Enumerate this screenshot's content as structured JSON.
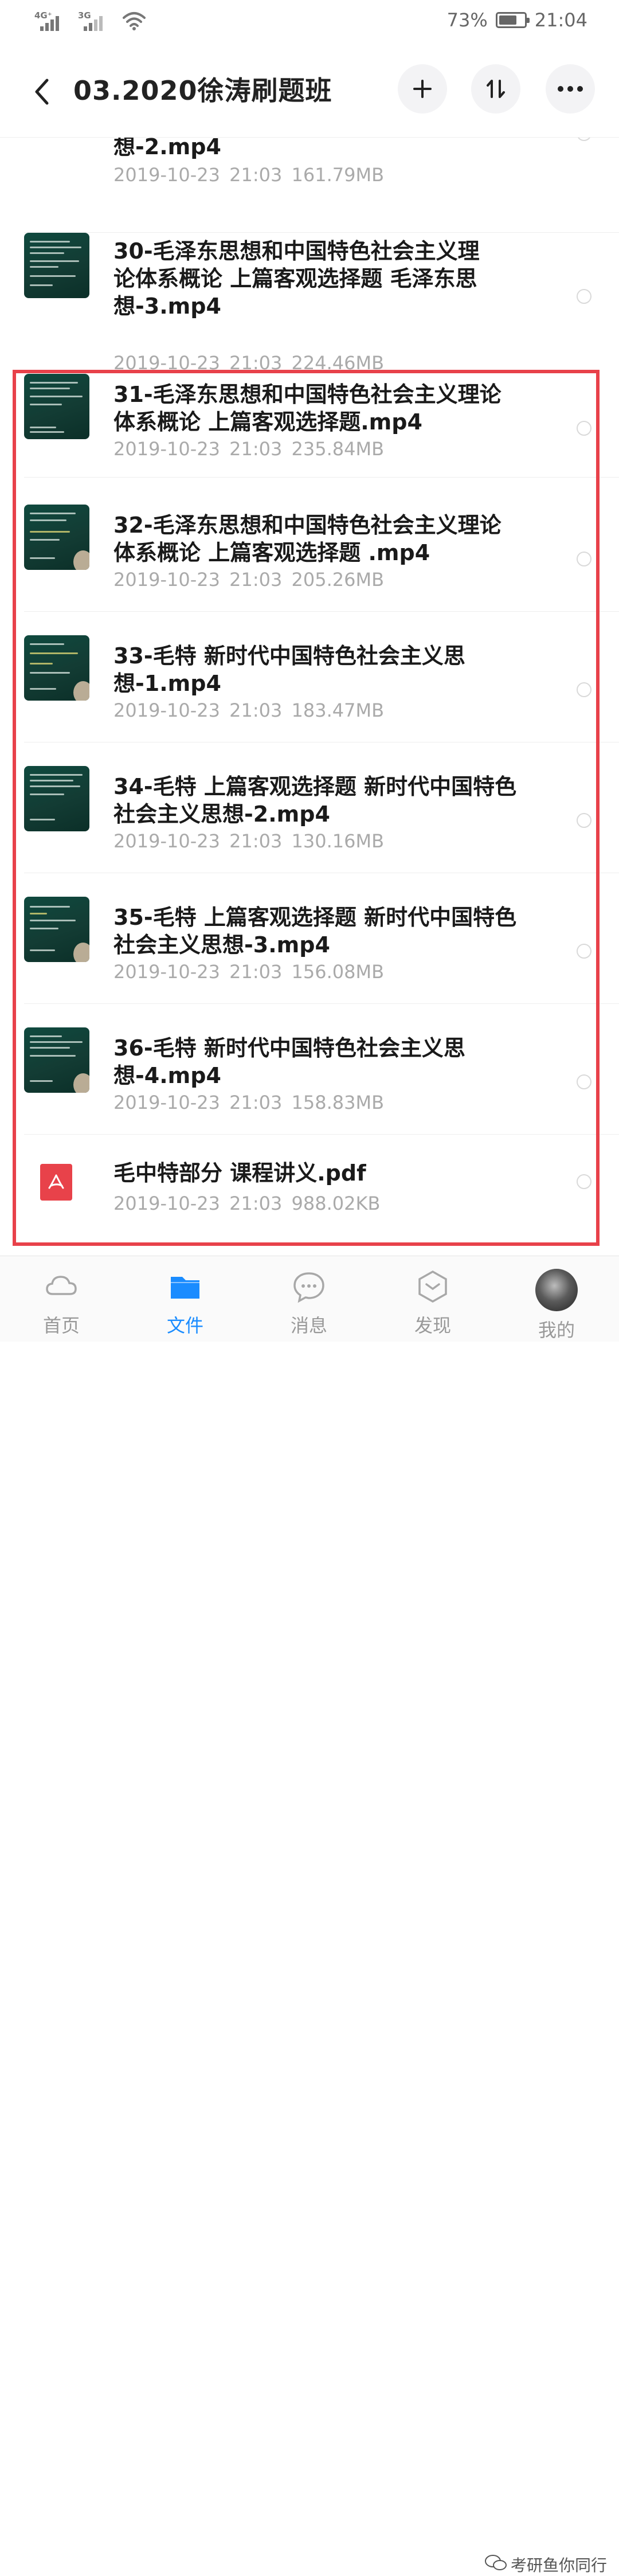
{
  "status": {
    "net1": "4G⁺",
    "net2": "3G",
    "battery": "73%",
    "battery_level": 0.73,
    "time": "21:04"
  },
  "header": {
    "title": "03.2020徐涛刷题班"
  },
  "files": [
    {
      "name": "想-2.mp4",
      "date": "2019-10-23",
      "time": "21:03",
      "size": "161.79MB",
      "type": "video"
    },
    {
      "name": "30-毛泽东思想和中国特色社会主义理\n论体系概论 上篇客观选择题 毛泽东思\n想-3.mp4",
      "date": "2019-10-23",
      "time": "21:03",
      "size": "224.46MB",
      "type": "video"
    },
    {
      "name": "31-毛泽东思想和中国特色社会主义理论\n体系概论 上篇客观选择题.mp4",
      "date": "2019-10-23",
      "time": "21:03",
      "size": "235.84MB",
      "type": "video"
    },
    {
      "name": "32-毛泽东思想和中国特色社会主义理论\n体系概论 上篇客观选择题 .mp4",
      "date": "2019-10-23",
      "time": "21:03",
      "size": "205.26MB",
      "type": "video"
    },
    {
      "name": "33-毛特 新时代中国特色社会主义思\n想-1.mp4",
      "date": "2019-10-23",
      "time": "21:03",
      "size": "183.47MB",
      "type": "video"
    },
    {
      "name": "34-毛特 上篇客观选择题 新时代中国特色\n社会主义思想-2.mp4",
      "date": "2019-10-23",
      "time": "21:03",
      "size": "130.16MB",
      "type": "video"
    },
    {
      "name": "35-毛特 上篇客观选择题 新时代中国特色\n社会主义思想-3.mp4",
      "date": "2019-10-23",
      "time": "21:03",
      "size": "156.08MB",
      "type": "video"
    },
    {
      "name": "36-毛特 新时代中国特色社会主义思\n想-4.mp4",
      "date": "2019-10-23",
      "time": "21:03",
      "size": "158.83MB",
      "type": "video"
    },
    {
      "name": "毛中特部分 课程讲义.pdf",
      "date": "2019-10-23",
      "time": "21:03",
      "size": "988.02KB",
      "type": "pdf"
    }
  ],
  "tabs": [
    {
      "label": "首页",
      "icon": "cloud-icon",
      "active": false
    },
    {
      "label": "文件",
      "icon": "folder-icon",
      "active": true
    },
    {
      "label": "消息",
      "icon": "message-icon",
      "active": false
    },
    {
      "label": "发现",
      "icon": "discover-icon",
      "active": false
    },
    {
      "label": "我的",
      "icon": "avatar",
      "active": false
    }
  ],
  "watermark": "考研鱼你同行",
  "colors": {
    "accent": "#1a8cff",
    "highlight_frame": "#e8414a",
    "pdf": "#e8424a"
  }
}
